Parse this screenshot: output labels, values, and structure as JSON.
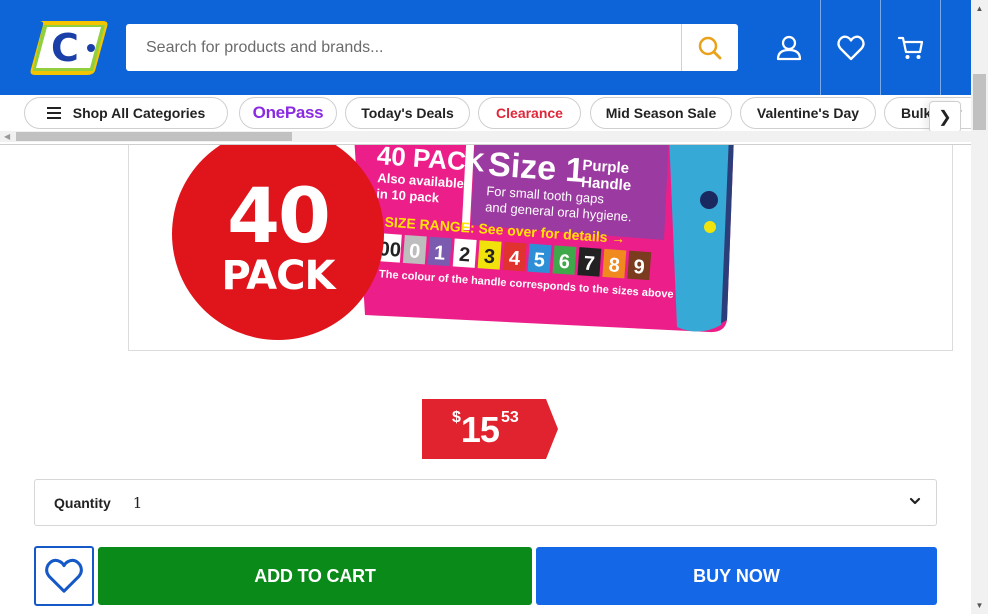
{
  "header": {
    "logo_text": "C",
    "search": {
      "placeholder": "Search for products and brands..."
    },
    "icons": [
      "user-icon",
      "heart-icon",
      "cart-icon"
    ]
  },
  "category_nav": {
    "items": [
      {
        "label": "Shop All Categories",
        "icon": "menu-icon"
      },
      {
        "label": "OnePass"
      },
      {
        "label": "Today's Deals"
      },
      {
        "label": "Clearance"
      },
      {
        "label": "Mid Season Sale"
      },
      {
        "label": "Valentine's Day"
      },
      {
        "label": "Bulk Buy"
      }
    ],
    "next_arrow": "❯"
  },
  "product_image": {
    "badge": {
      "number": "40",
      "word": "PACK"
    },
    "box": {
      "pack_title": "40 PACK",
      "pack_sub1": "Also available",
      "pack_sub2": "in 10 pack",
      "size_title": "Size 1",
      "size_handle1": "Purple",
      "size_handle2": "Handle",
      "size_desc1": "For small tooth gaps",
      "size_desc2": "and general oral hygiene.",
      "range_label": "SIZE RANGE: See over for details →",
      "sizes": [
        "00",
        "0",
        "1",
        "2",
        "3",
        "4",
        "5",
        "6",
        "7",
        "8",
        "9"
      ],
      "footer": "The colour of the handle corresponds to the sizes above"
    }
  },
  "price": {
    "currency": "$",
    "dollars": "15",
    "cents": "53"
  },
  "quantity": {
    "label": "Quantity",
    "value": "1"
  },
  "actions": {
    "add_to_cart": "ADD TO CART",
    "buy_now": "BUY NOW"
  },
  "colors": {
    "header_blue": "#0d63d8",
    "price_red": "#e0232e",
    "cart_green": "#0a8a18",
    "buy_blue": "#1467e6",
    "clearance_red": "#e0273a",
    "onepass_purple": "#8a2be2"
  }
}
